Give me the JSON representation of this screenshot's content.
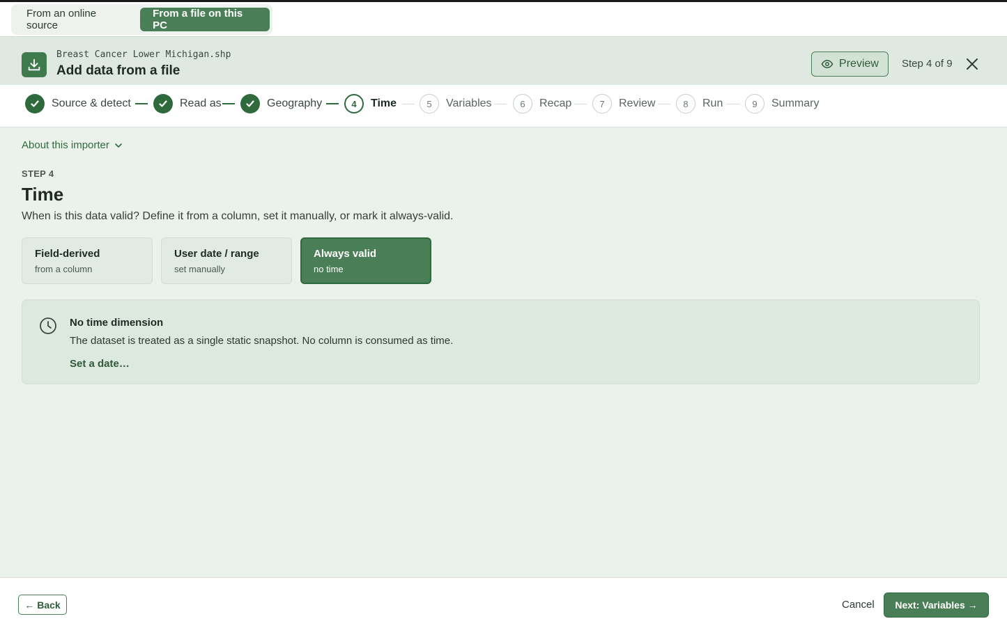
{
  "source_tabs": {
    "online": "From an online source",
    "file": "From a file on this PC"
  },
  "header": {
    "filename": "Breast Cancer Lower Michigan.shp",
    "title": "Add data from a file",
    "preview_label": "Preview",
    "step_count": "Step 4 of 9",
    "icon": "download-icon"
  },
  "stepper": {
    "steps": [
      {
        "number": "1",
        "label": "Source & detect",
        "state": "done"
      },
      {
        "number": "2",
        "label": "Read as",
        "state": "done"
      },
      {
        "number": "3",
        "label": "Geography",
        "state": "done"
      },
      {
        "number": "4",
        "label": "Time",
        "state": "current"
      },
      {
        "number": "5",
        "label": "Variables",
        "state": "future"
      },
      {
        "number": "6",
        "label": "Recap",
        "state": "future"
      },
      {
        "number": "7",
        "label": "Review",
        "state": "future"
      },
      {
        "number": "8",
        "label": "Run",
        "state": "future"
      },
      {
        "number": "9",
        "label": "Summary",
        "state": "future"
      }
    ]
  },
  "main": {
    "about_label": "About this importer",
    "eyebrow": "STEP 4",
    "title": "Time",
    "description": "When is this data valid? Define it from a column, set it manually, or mark it always-valid.",
    "options": [
      {
        "title": "Field-derived",
        "subtitle": "from a column",
        "selected": false
      },
      {
        "title": "User date / range",
        "subtitle": "set manually",
        "selected": false
      },
      {
        "title": "Always valid",
        "subtitle": "no time",
        "selected": true
      }
    ],
    "info": {
      "title": "No time dimension",
      "text": "The dataset is treated as a single static snapshot. No column is consumed as time.",
      "link": "Set a date…",
      "icon": "clock-icon"
    }
  },
  "footer": {
    "back_label": "← Back",
    "cancel_label": "Cancel",
    "next_label": "Next: Variables →"
  },
  "colors": {
    "accent": "#4a7e56",
    "accent_dark": "#2f6a3d",
    "header_bg": "#dfe9e1",
    "main_bg": "#ebf2ec"
  }
}
